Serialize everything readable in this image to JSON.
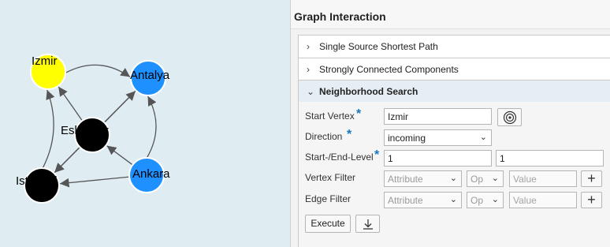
{
  "graph": {
    "nodes": [
      {
        "id": "izmir",
        "label": "Izmir",
        "color": "#ffff00"
      },
      {
        "id": "antalya",
        "label": "Antalya",
        "color": "#1e90ff"
      },
      {
        "id": "eskisehir",
        "label": "Eskişehir",
        "color": "#000000"
      },
      {
        "id": "ankara",
        "label": "Ankara",
        "color": "#1e90ff"
      },
      {
        "id": "istanbul",
        "label": "Istanbul",
        "color": "#000000"
      }
    ],
    "edges": [
      {
        "from": "izmir",
        "to": "antalya"
      },
      {
        "from": "eskisehir",
        "to": "izmir"
      },
      {
        "from": "eskisehir",
        "to": "antalya"
      },
      {
        "from": "eskisehir",
        "to": "istanbul"
      },
      {
        "from": "ankara",
        "to": "eskisehir"
      },
      {
        "from": "ankara",
        "to": "antalya"
      },
      {
        "from": "ankara",
        "to": "istanbul"
      },
      {
        "from": "istanbul",
        "to": "izmir"
      },
      {
        "from": "antalya",
        "to": "istanbul"
      }
    ]
  },
  "panel": {
    "title": "Graph Interaction",
    "sections": {
      "shortest_path": "Single Source Shortest Path",
      "scc": "Strongly Connected Components",
      "neighborhood": "Neighborhood Search"
    },
    "form": {
      "start_vertex_label": "Start Vertex",
      "start_vertex_value": "Izmir",
      "direction_label": "Direction",
      "direction_value": "incoming",
      "level_label": "Start-/End-Level",
      "start_level": "1",
      "end_level": "1",
      "vertex_filter_label": "Vertex Filter",
      "edge_filter_label": "Edge Filter",
      "attribute_placeholder": "Attribute",
      "op_placeholder": "Op",
      "value_placeholder": "Value",
      "required_mark": "*"
    },
    "buttons": {
      "execute": "Execute"
    }
  },
  "icons": {
    "expand": "chevron-right-icon",
    "collapse": "chevron-down-icon",
    "target": "target-icon",
    "add": "plus-icon",
    "download": "download-icon"
  },
  "colors": {
    "canvas_bg": "#dfedf3",
    "accent": "#1b75bb",
    "open_section_bg": "#e6eef5"
  }
}
